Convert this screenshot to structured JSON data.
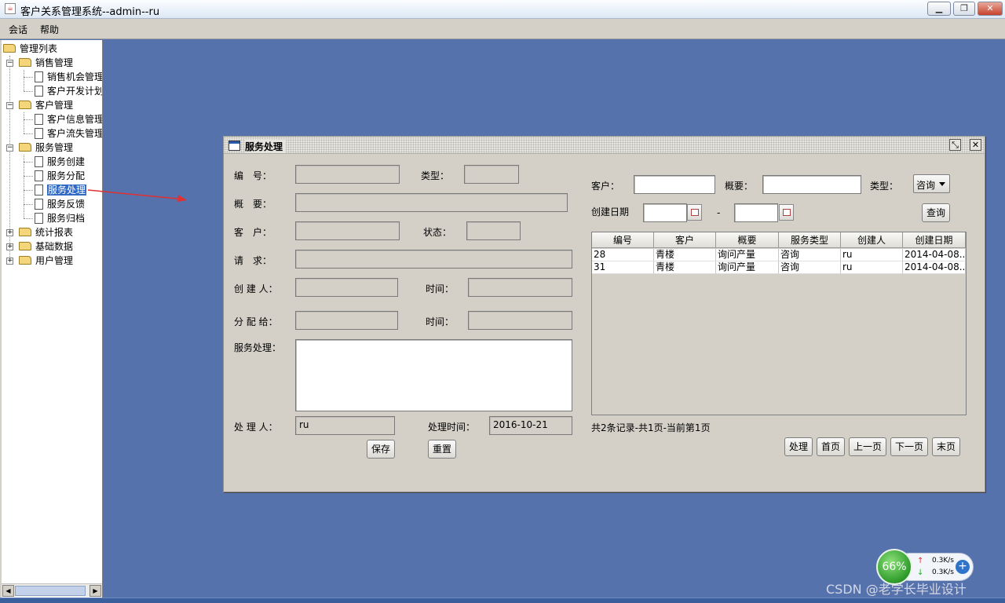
{
  "window": {
    "title": "客户关系管理系统--admin--ru",
    "min_icon": "minimize-icon",
    "max_icon": "maximize-icon",
    "close_icon": "close-icon"
  },
  "menu": [
    "会话",
    "帮助"
  ],
  "tree": {
    "root": "管理列表",
    "groups": [
      {
        "label": "销售管理",
        "items": [
          "销售机会管理",
          "客户开发计划"
        ]
      },
      {
        "label": "客户管理",
        "items": [
          "客户信息管理",
          "客户流失管理"
        ]
      },
      {
        "label": "服务管理",
        "items": [
          "服务创建",
          "服务分配",
          "服务处理",
          "服务反馈",
          "服务归档"
        ],
        "selected": "服务处理"
      },
      {
        "label": "统计报表",
        "items": []
      },
      {
        "label": "基础数据",
        "items": []
      },
      {
        "label": "用户管理",
        "items": []
      }
    ]
  },
  "internal_frame": {
    "title": "服务处理",
    "restore_icon": "restore-icon",
    "close_icon": "close-icon"
  },
  "form": {
    "number_label": "编　号：",
    "type_label": "类型：",
    "summary_label": "概　要：",
    "customer_label": "客　户：",
    "status_label": "状态：",
    "request_label": "请　求：",
    "creator_label": "创 建 人：",
    "create_time_label": "时间：",
    "assignee_label": "分 配 给：",
    "assign_time_label": "时间：",
    "handling_label": "服务处理：",
    "handler_label": "处 理 人：",
    "handler_value": "ru",
    "handle_time_label": "处理时间：",
    "handle_time_value": "2016-10-21",
    "save_label": "保存",
    "reset_label": "重置"
  },
  "search": {
    "customer_label": "客户：",
    "summary_label": "概要：",
    "type_label": "类型：",
    "type_value": "咨询",
    "created_label": "创建日期",
    "date_separator": "-",
    "query_label": "查询"
  },
  "table": {
    "columns": [
      "编号",
      "客户",
      "概要",
      "服务类型",
      "创建人",
      "创建日期"
    ],
    "rows": [
      [
        "28",
        "青楼",
        "询问产量",
        "咨询",
        "ru",
        "2014-04-08..."
      ],
      [
        "31",
        "青楼",
        "询问产量",
        "咨询",
        "ru",
        "2014-04-08..."
      ]
    ]
  },
  "pagination": {
    "summary": "共2条记录-共1页-当前第1页",
    "handle_label": "处理",
    "first_label": "首页",
    "prev_label": "上一页",
    "next_label": "下一页",
    "last_label": "末页"
  },
  "net_widget": {
    "percent": "66%",
    "up_speed": "0.3K/s",
    "down_speed": "0.3K/s"
  },
  "watermark": "CSDN @老学长毕业设计",
  "colors": {
    "desktop": "#5672ac",
    "panel": "#d4d0c8",
    "selection": "#316ac5",
    "arrow": "#e03030"
  }
}
